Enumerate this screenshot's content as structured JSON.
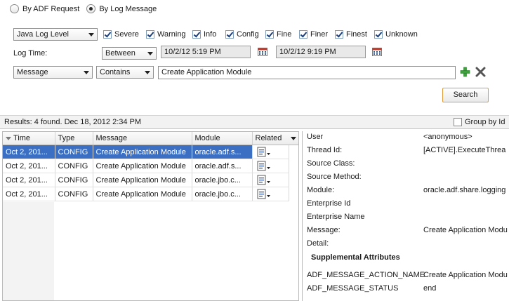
{
  "filter_mode": {
    "options": [
      "By ADF Request",
      "By Log Message"
    ],
    "selected": "By Log Message"
  },
  "log_level": {
    "selected": "Java Log Level",
    "levels": [
      {
        "label": "Severe",
        "checked": true
      },
      {
        "label": "Warning",
        "checked": true
      },
      {
        "label": "Info",
        "checked": true
      },
      {
        "label": "Config",
        "checked": true
      },
      {
        "label": "Fine",
        "checked": true
      },
      {
        "label": "Finer",
        "checked": true
      },
      {
        "label": "Finest",
        "checked": true
      },
      {
        "label": "Unknown",
        "checked": true
      }
    ]
  },
  "log_time": {
    "label": "Log Time:",
    "operator": "Between",
    "from": "10/2/12 5:19 PM",
    "to": "10/2/12 9:19 PM"
  },
  "criteria": {
    "field": "Message",
    "operator": "Contains",
    "value": "Create Application Module"
  },
  "search_button": "Search",
  "results": {
    "summary": "Results:  4 found. Dec 18, 2012 2:34 PM",
    "group_by_label": "Group by Id",
    "columns": [
      "Time",
      "Type",
      "Message",
      "Module",
      "Related"
    ],
    "rows": [
      {
        "time": "Oct 2, 201...",
        "type": "CONFIG",
        "message": "Create Application Module",
        "module": "oracle.adf.s...",
        "selected": true
      },
      {
        "time": "Oct 2, 201...",
        "type": "CONFIG",
        "message": "Create Application Module",
        "module": "oracle.adf.s...",
        "selected": false
      },
      {
        "time": "Oct 2, 201...",
        "type": "CONFIG",
        "message": "Create Application Module",
        "module": "oracle.jbo.c...",
        "selected": false
      },
      {
        "time": "Oct 2, 201...",
        "type": "CONFIG",
        "message": "Create Application Module",
        "module": "oracle.jbo.c...",
        "selected": false
      }
    ]
  },
  "details": {
    "user": {
      "label": "User",
      "value": "<anonymous>"
    },
    "thread_id": {
      "label": "Thread Id:",
      "value": "[ACTIVE].ExecuteThrea"
    },
    "source_class": {
      "label": "Source Class:",
      "value": ""
    },
    "source_method": {
      "label": "Source Method:",
      "value": ""
    },
    "module": {
      "label": "Module:",
      "value": "oracle.adf.share.logging"
    },
    "enterprise_id": {
      "label": "Enterprise Id",
      "value": ""
    },
    "enterprise_name": {
      "label": "Enterprise Name",
      "value": ""
    },
    "message": {
      "label": "Message:",
      "value": "Create Application Modu"
    },
    "detail": {
      "label": "Detail:",
      "value": ""
    },
    "supplemental_title": "Supplemental Attributes",
    "attr_action": {
      "label": "ADF_MESSAGE_ACTION_NAME",
      "value": "Create Application Modu"
    },
    "attr_status": {
      "label": "ADF_MESSAGE_STATUS",
      "value": "end"
    }
  },
  "colors": {
    "selection": "#3a6fc4",
    "search_border": "#e09b3a",
    "add_icon": "#3aa33a",
    "remove_icon": "#555555"
  }
}
